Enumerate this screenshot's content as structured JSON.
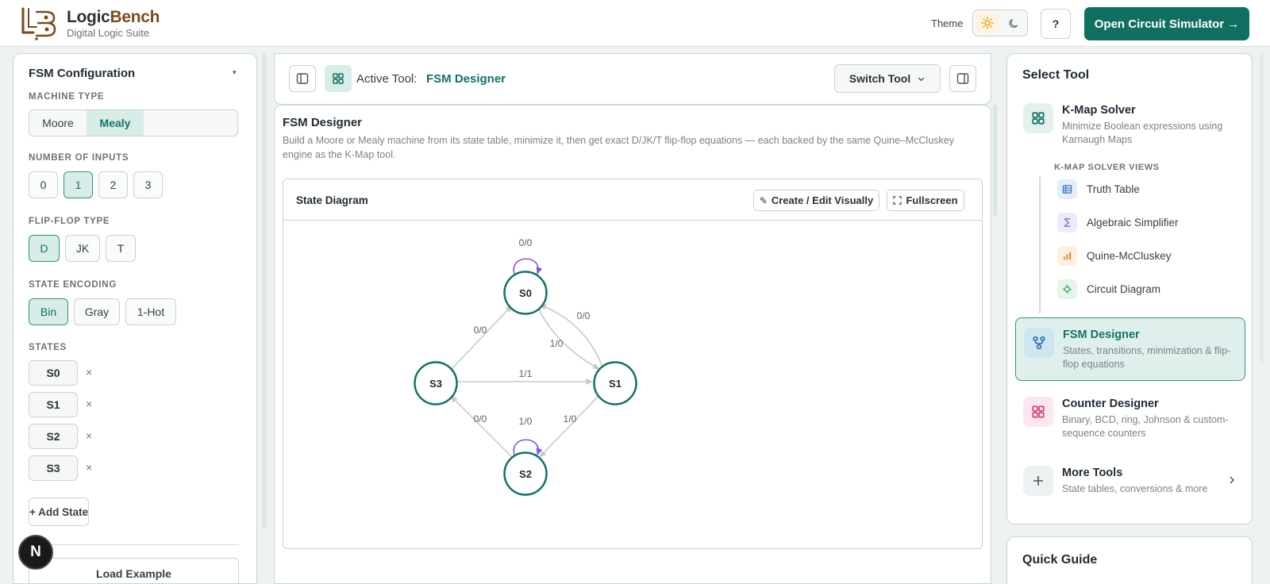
{
  "header": {
    "brand_part1": "Logic",
    "brand_part2": "Bench",
    "subtitle": "Digital Logic Suite",
    "theme_label": "Theme",
    "help_label": "?",
    "open_simulator_label": "Open Circuit Simulator →"
  },
  "left_panel": {
    "title": "FSM Configuration",
    "caret": "▾",
    "machine_type": {
      "label": "MACHINE TYPE",
      "options": [
        "Moore",
        "Mealy"
      ],
      "selected": "Mealy"
    },
    "inputs": {
      "label": "NUMBER OF INPUTS",
      "options": [
        "0",
        "1",
        "2",
        "3"
      ],
      "selected": "1"
    },
    "flipflop": {
      "label": "FLIP-FLOP TYPE",
      "options": [
        "D",
        "JK",
        "T"
      ],
      "selected": "D"
    },
    "encoding": {
      "label": "STATE ENCODING",
      "options": [
        "Bin",
        "Gray",
        "1-Hot"
      ],
      "selected": "Bin"
    },
    "states": {
      "label": "STATES",
      "items": [
        "S0",
        "S1",
        "S2",
        "S3"
      ],
      "remove_glyph": "×"
    },
    "add_state_label": "+ Add State",
    "load_example_label": "Load Example",
    "n_badge": "N"
  },
  "toolbar": {
    "active_tool_label": "Active Tool:",
    "active_tool_value": "FSM Designer",
    "switch_tool_label": "Switch Tool"
  },
  "main": {
    "title": "FSM Designer",
    "description": "Build a Moore or Mealy machine from its state table, minimize it, then get exact D/JK/T flip-flop equations — each backed by the same Quine–McCluskey engine as the K-Map tool.",
    "diagram": {
      "title": "State Diagram",
      "edit_label": "Create / Edit Visually",
      "fullscreen_label": "Fullscreen"
    }
  },
  "fsm_graph": {
    "states": [
      {
        "name": "S0"
      },
      {
        "name": "S1"
      },
      {
        "name": "S2"
      },
      {
        "name": "S3"
      }
    ],
    "transitions": [
      {
        "from": "S0",
        "to": "S0",
        "label": "0/0"
      },
      {
        "from": "S0",
        "to": "S1",
        "label": "1/0"
      },
      {
        "from": "S1",
        "to": "S0",
        "label": "0/0"
      },
      {
        "from": "S1",
        "to": "S2",
        "label": "1/0"
      },
      {
        "from": "S2",
        "to": "S2",
        "label": "1/0"
      },
      {
        "from": "S2",
        "to": "S3",
        "label": "0/0"
      },
      {
        "from": "S3",
        "to": "S0",
        "label": "0/0"
      },
      {
        "from": "S3",
        "to": "S1",
        "label": "1/1"
      }
    ],
    "colors": {
      "node_stroke": "#137266",
      "edge": "#c2cbcf",
      "self_loop": "#7b5cd6"
    }
  },
  "right_panel": {
    "title": "Select Tool",
    "kmap": {
      "name": "K-Map Solver",
      "desc": "Minimize Boolean expressions using Karnaugh Maps"
    },
    "views_label": "K-MAP SOLVER VIEWS",
    "views": [
      "Truth Table",
      "Algebraic Simplifier",
      "Quine-McCluskey",
      "Circuit Diagram"
    ],
    "fsm": {
      "name": "FSM Designer",
      "desc": "States, transitions, minimization & flip-flop equations"
    },
    "counter": {
      "name": "Counter Designer",
      "desc": "Binary, BCD, ring, Johnson & custom-sequence counters"
    },
    "more": {
      "name": "More Tools",
      "desc": "State tables, conversions & more"
    }
  },
  "quick_guide": {
    "title": "Quick Guide"
  },
  "colors": {
    "accent": "#116f62",
    "accent_light": "#d8ece8",
    "brand_brown": "#7a4a1e"
  }
}
